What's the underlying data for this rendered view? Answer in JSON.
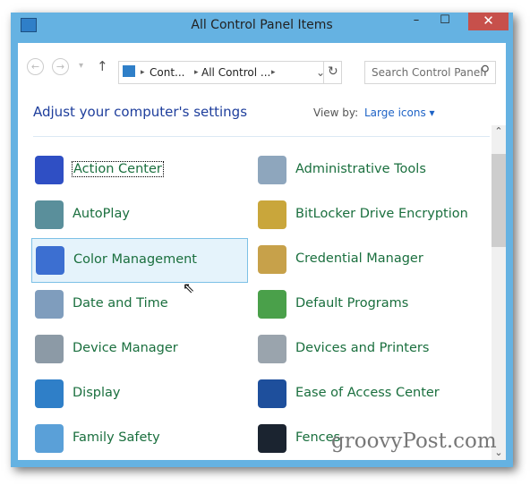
{
  "window": {
    "title": "All Control Panel Items",
    "minimize": "–",
    "maximize": "☐",
    "close": "✕"
  },
  "nav": {
    "back": "←",
    "forward": "→",
    "recent": "▾",
    "up": "↑",
    "breadcrumb": [
      "Cont...",
      "All Control ..."
    ],
    "sep": "▸",
    "dropdown": "⌄",
    "refresh": "↻",
    "search_placeholder": "Search Control Panel",
    "search_icon": "⚲"
  },
  "header": {
    "title": "Adjust your computer's settings",
    "view_by_label": "View by:",
    "view_by_value": "Large icons ▾"
  },
  "items": [
    {
      "label": "Action Center",
      "icon": "flag-icon",
      "color": "#2f4fc4"
    },
    {
      "label": "Administrative Tools",
      "icon": "gear-checklist-icon",
      "color": "#8ea6bd"
    },
    {
      "label": "AutoPlay",
      "icon": "autoplay-icon",
      "color": "#5a8f9b"
    },
    {
      "label": "BitLocker Drive Encryption",
      "icon": "lock-drive-icon",
      "color": "#c9a63b"
    },
    {
      "label": "Color Management",
      "icon": "color-monitor-icon",
      "color": "#3c6fd1"
    },
    {
      "label": "Credential Manager",
      "icon": "vault-icon",
      "color": "#c7a14a"
    },
    {
      "label": "Date and Time",
      "icon": "calendar-clock-icon",
      "color": "#7f9dbd"
    },
    {
      "label": "Default Programs",
      "icon": "default-programs-icon",
      "color": "#4aa04a"
    },
    {
      "label": "Device Manager",
      "icon": "device-manager-icon",
      "color": "#8c9aa6"
    },
    {
      "label": "Devices and Printers",
      "icon": "printer-icon",
      "color": "#9aa4ad"
    },
    {
      "label": "Display",
      "icon": "display-icon",
      "color": "#2f7fc8"
    },
    {
      "label": "Ease of Access Center",
      "icon": "ease-of-access-icon",
      "color": "#1e4f9c"
    },
    {
      "label": "Family Safety",
      "icon": "family-icon",
      "color": "#5aa0d8"
    },
    {
      "label": "Fences",
      "icon": "fences-icon",
      "color": "#1b2430"
    }
  ],
  "scrollbar": {
    "up": "⌃",
    "down": "⌄"
  },
  "watermark": "groovyPost.com"
}
